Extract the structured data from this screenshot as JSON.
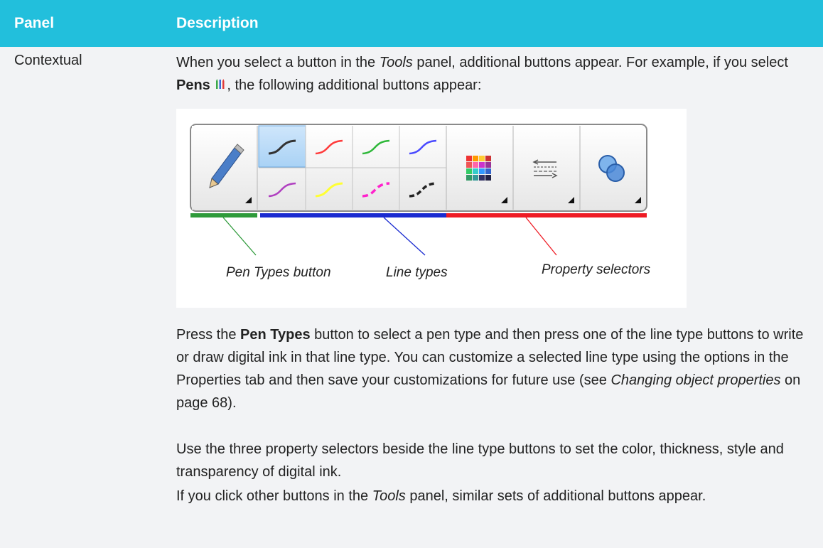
{
  "table": {
    "header": {
      "col1": "Panel",
      "col2": "Description"
    },
    "row": {
      "panel": "Contextual",
      "p1": {
        "t1": "When you select a button in the ",
        "t2": "Tools",
        "t3": " panel, additional buttons appear. For example, if you select ",
        "t4": "Pens",
        "t5": ", the following additional buttons appear:"
      },
      "figure": {
        "captions": {
          "pen_types": "Pen Types button",
          "line_types": "Line types",
          "property": "Property selectors"
        },
        "colors": {
          "pen_types_bar": "#2e9a3a",
          "line_types_bar": "#1a2bd0",
          "property_bar": "#ee1b24"
        },
        "line_swatch_colors": [
          "#333333",
          "#ff3b3b",
          "#2fb83a",
          "#4a4aff",
          "#b040c0",
          "#ffff33",
          "#ff22cc",
          "#222222"
        ]
      },
      "p2": {
        "t1": "Press the ",
        "t2": "Pen Types",
        "t3": " button to select a pen type and then press one of the line type buttons to write or draw digital ink in that line type. You can customize a selected line type using the options in the Properties tab and then save your customizations for future use (see ",
        "t4": "Changing object properties",
        "t5": " on page 68)."
      },
      "p3": "Use the three property selectors beside the line type buttons to set the color, thickness, style and transparency of digital ink.",
      "p4": {
        "t1": "If you click other buttons in the ",
        "t2": "Tools",
        "t3": " panel, similar sets of additional buttons appear."
      }
    }
  }
}
